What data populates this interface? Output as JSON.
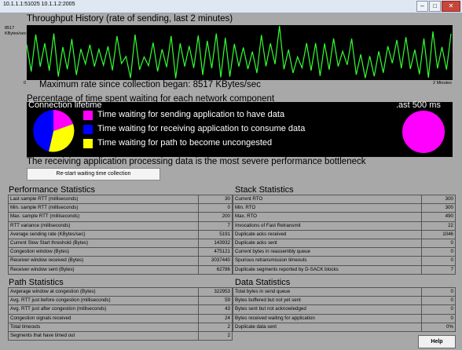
{
  "window": {
    "title": "10.1.1.1:51025 10.1.1.2:2005"
  },
  "throughput": {
    "title": "Throughput History (rate of sending, last 2 minutes)",
    "y_max_label": "8517",
    "y_unit_label": "KBytes/sec",
    "y_min_label": "0",
    "x_right_label": "2 Minutes",
    "max_rate_text": "Maximum rate since collection began: 8517 KBytes/sec",
    "line_color": "#32ff32"
  },
  "waiting": {
    "title": "Percentage of time spent waiting for each network component",
    "left_label": "Connection lifetime",
    "right_label": ".ast 500 ms",
    "legend": [
      {
        "label": "Time waiting for sending application to have data",
        "color": "#ff00ff"
      },
      {
        "label": "Time waiting for receiving application to consume data",
        "color": "#0000ff"
      },
      {
        "label": "Time waiting for path to become uncongested",
        "color": "#ffff00"
      }
    ],
    "summary": "The receiving application processing data is the most severe performance bottleneck",
    "restart_label": "Re-start waiting time collection"
  },
  "performance": {
    "title": "Performance Statistics",
    "rows": [
      {
        "label": "Last sample RTT (milliseconds)",
        "value": "30"
      },
      {
        "label": "Min. sample RTT (milliseconds)",
        "value": "0"
      },
      {
        "label": "Max. sample RTT (milliseconds)",
        "value": "200"
      },
      {
        "label": "RTT variance (milliseconds)",
        "value": "7"
      },
      {
        "label": "Average sending rate (KBytes/sec)",
        "value": "5191"
      },
      {
        "label": "Current Slow Start threshold (Bytes)",
        "value": "143932"
      },
      {
        "label": "Congestion window (Bytes)",
        "value": "475121"
      },
      {
        "label": "Receiver window received (Bytes)",
        "value": "3037440"
      },
      {
        "label": "Receiver window sent (Bytes)",
        "value": "62786"
      }
    ]
  },
  "stack": {
    "title": "Stack Statistics",
    "rows": [
      {
        "label": "Current RTO",
        "value": "300"
      },
      {
        "label": "Min. RTO",
        "value": "300"
      },
      {
        "label": "Max. RTO",
        "value": "490"
      },
      {
        "label": "Invocations of Fast Retransmit",
        "value": "22"
      },
      {
        "label": "Duplicate acks received",
        "value": "1046"
      },
      {
        "label": "Duplicate acks sent",
        "value": "0"
      },
      {
        "label": "Current bytes in reassembly queue",
        "value": "0"
      },
      {
        "label": "Spurious retransmission timeouts",
        "value": "0"
      },
      {
        "label": "Duplicate segments reported by D-SACK blocks",
        "value": "7"
      }
    ]
  },
  "path": {
    "title": "Path Statistics",
    "rows": [
      {
        "label": "Avgerage window at congestion (Bytes)",
        "value": "322953"
      },
      {
        "label": "Avg. RTT just before congestion (milliseconds)",
        "value": "59"
      },
      {
        "label": "Avg. RTT just after congestion (milliseconds)",
        "value": "43"
      },
      {
        "label": "Congestion signals received",
        "value": "24"
      },
      {
        "label": "Total timeouts",
        "value": "2"
      },
      {
        "label": "Segments that have timed out",
        "value": "2"
      }
    ]
  },
  "datastats": {
    "title": "Data Statistics",
    "rows": [
      {
        "label": "Total bytes in send queue",
        "value": "0"
      },
      {
        "label": "Bytes buffered but not yet sent",
        "value": "0"
      },
      {
        "label": "Bytes sent but not acknowledged",
        "value": "0"
      },
      {
        "label": "Bytes received waiting for application",
        "value": "0"
      },
      {
        "label": "Duplicate data sent",
        "value": "0%"
      }
    ]
  },
  "help_label": "Help"
}
